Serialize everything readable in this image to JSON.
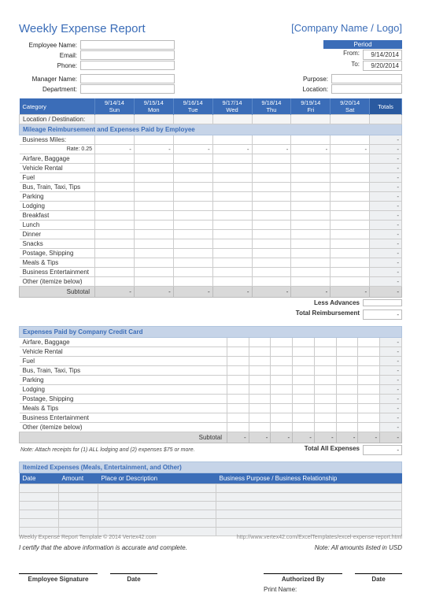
{
  "title": "Weekly Expense Report",
  "brand": "[Company Name / Logo]",
  "emp_fields": {
    "name": "Employee Name:",
    "email": "Email:",
    "phone": "Phone:",
    "manager": "Manager Name:",
    "dept": "Department:"
  },
  "period": {
    "hdr": "Period",
    "from_lbl": "From:",
    "from": "9/14/2014",
    "to_lbl": "To:",
    "to": "9/20/2014"
  },
  "right_fields": {
    "purpose": "Purpose:",
    "location": "Location:"
  },
  "columns": {
    "cat": "Category",
    "days": [
      {
        "date": "9/14/14",
        "dow": "Sun"
      },
      {
        "date": "9/15/14",
        "dow": "Mon"
      },
      {
        "date": "9/16/14",
        "dow": "Tue"
      },
      {
        "date": "9/17/14",
        "dow": "Wed"
      },
      {
        "date": "9/18/14",
        "dow": "Thu"
      },
      {
        "date": "9/19/14",
        "dow": "Fri"
      },
      {
        "date": "9/20/14",
        "dow": "Sat"
      }
    ],
    "totals": "Totals"
  },
  "locdest": "Location / Destination:",
  "sec1": {
    "hdr": "Mileage Reimbursement and Expenses Paid by Employee",
    "miles": "Business Miles:",
    "rate_lbl": "Rate:",
    "rate": "0.25",
    "rows": [
      "Airfare, Baggage",
      "Vehicle Rental",
      "Fuel",
      "Bus, Train, Taxi, Tips",
      "Parking",
      "Lodging",
      "Breakfast",
      "Lunch",
      "Dinner",
      "Snacks",
      "Postage, Shipping",
      "Meals & Tips",
      "Business Entertainment",
      "Other (itemize below)"
    ],
    "subtotal": "Subtotal",
    "less": "Less Advances",
    "totreimb": "Total Reimbursement"
  },
  "sec2": {
    "hdr": "Expenses Paid by Company Credit Card",
    "rows": [
      "Airfare, Baggage",
      "Vehicle Rental",
      "Fuel",
      "Bus, Train, Taxi, Tips",
      "Parking",
      "Lodging",
      "Postage, Shipping",
      "Meals & Tips",
      "Business Entertainment",
      "Other (itemize below)"
    ],
    "subtotal": "Subtotal",
    "note": "Note: Attach receipts for (1) ALL lodging and (2) expenses $75 or more.",
    "totall": "Total All Expenses"
  },
  "sec3": {
    "hdr": "Itemized Expenses (Meals, Entertainment, and Other)",
    "cols": {
      "date": "Date",
      "amount": "Amount",
      "place": "Place or Description",
      "purpose": "Business Purpose / Business Relationship"
    }
  },
  "cert": "I certify that the above information is accurate and complete.",
  "amt_note": "Note: All amounts listed in USD",
  "sigs": {
    "emp": "Employee Signature",
    "date": "Date",
    "auth": "Authorized By",
    "print": "Print Name:"
  },
  "foot": {
    "left": "Weekly Expense Report Template © 2014 Vertex42.com",
    "right": "http://www.vertex42.com/ExcelTemplates/excel-expense-report.html"
  },
  "dash": "-"
}
